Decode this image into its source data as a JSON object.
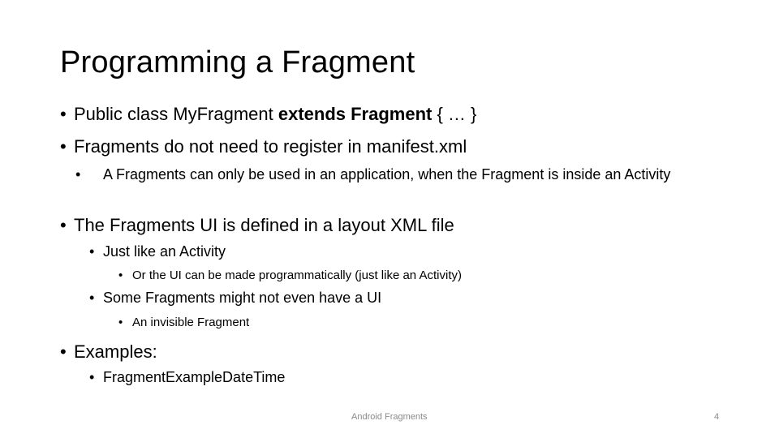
{
  "slide": {
    "title": "Programming a Fragment",
    "bullet_glyph": "•",
    "items": [
      {
        "level": 1,
        "parts": {
          "pre": "Public class MyFragment ",
          "bold": "extends Fragment",
          "post": " { … }"
        }
      },
      {
        "level": 1,
        "text": "Fragments do not need to register in manifest.xml"
      },
      {
        "level": 2,
        "text": "A Fragments can only be used in an application, when the Fragment is inside an Activity"
      },
      {
        "level": 1,
        "text": "The Fragments UI is defined in a layout XML file"
      },
      {
        "level": 2,
        "text": "Just like an Activity"
      },
      {
        "level": 3,
        "text": "Or the UI can be made programmatically (just like an Activity)"
      },
      {
        "level": 2,
        "text": "Some Fragments might not even have a UI"
      },
      {
        "level": 3,
        "text": "An invisible Fragment"
      },
      {
        "level": 1,
        "text": "Examples:"
      },
      {
        "level": 2,
        "text": "FragmentExampleDateTime"
      }
    ]
  },
  "footer": {
    "center": "Android Fragments",
    "page_number": "4"
  }
}
